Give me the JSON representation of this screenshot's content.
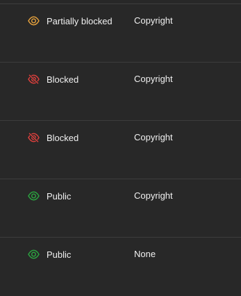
{
  "colors": {
    "background": "#282828",
    "divider": "#3d3d3d",
    "partially_blocked": "#e8a33d",
    "blocked": "#e0403d",
    "public": "#2ba640"
  },
  "rows": [
    {
      "visibility": "Partially blocked",
      "icon": "eye-icon",
      "status": "partially_blocked",
      "restrictions": "Copyright"
    },
    {
      "visibility": "Blocked",
      "icon": "eye-off-icon",
      "status": "blocked",
      "restrictions": "Copyright"
    },
    {
      "visibility": "Blocked",
      "icon": "eye-off-icon",
      "status": "blocked",
      "restrictions": "Copyright"
    },
    {
      "visibility": "Public",
      "icon": "eye-icon",
      "status": "public",
      "restrictions": "Copyright"
    },
    {
      "visibility": "Public",
      "icon": "eye-icon",
      "status": "public",
      "restrictions": "None"
    }
  ]
}
